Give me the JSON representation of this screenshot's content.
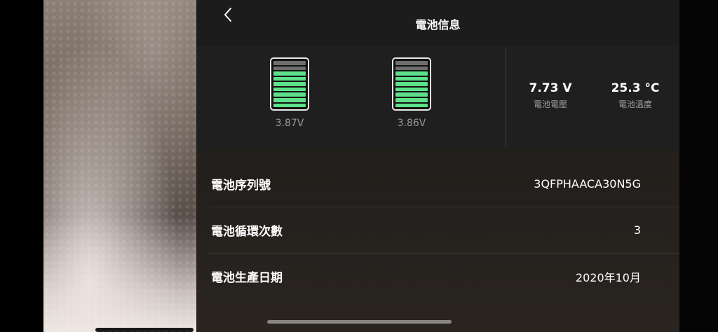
{
  "header": {
    "title": "電池信息",
    "back_icon": "chevron-left-icon"
  },
  "cells": [
    {
      "voltage": "3.87V",
      "level_fraction": 0.78
    },
    {
      "voltage": "3.86V",
      "level_fraction": 0.78
    }
  ],
  "stats": {
    "voltage": {
      "value": "7.73 V",
      "label": "電池電壓"
    },
    "temperature": {
      "value": "25.3 °C",
      "label": "電池溫度"
    }
  },
  "info": [
    {
      "label": "電池序列號",
      "value": "3QFPHAACA30N5G"
    },
    {
      "label": "電池循環次數",
      "value": "3"
    },
    {
      "label": "電池生產日期",
      "value": "2020年10月"
    }
  ],
  "colors": {
    "battery_full": "#5ee08a",
    "battery_empty": "#6e6e6e"
  }
}
